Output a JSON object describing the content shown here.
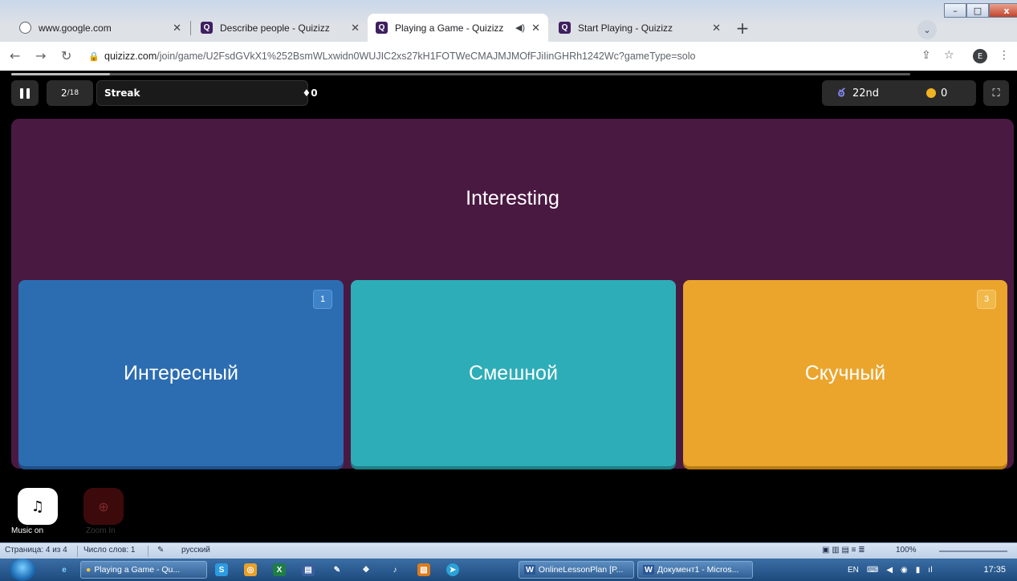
{
  "browser": {
    "tabs": [
      {
        "title": "www.google.com",
        "icon": "globe-icon"
      },
      {
        "title": "Describe people - Quizizz",
        "icon": "quizizz-icon"
      },
      {
        "title": "Playing a Game - Quizizz",
        "icon": "quizizz-icon",
        "active": true
      },
      {
        "title": "Start Playing - Quizizz",
        "icon": "quizizz-icon"
      }
    ],
    "tab_close_glyph": "✕",
    "new_tab_glyph": "+",
    "url_domain": "quizizz.com",
    "url_path": "/join/game/U2FsdGVkX1%252BsmWLxwidn0WUJIC2xs27kH1FOTWeCMAJMJMOfFJiIinGHRh1242Wc?gameType=solo",
    "profile_initial": "E"
  },
  "game": {
    "progress_fraction": 0.11,
    "question_number": "2",
    "question_total": "/18",
    "streak_label": "Streak",
    "streak_count": "0",
    "rank": "22nd",
    "coins": "0",
    "question_text": "Interesting",
    "options": [
      {
        "text": "Интересный",
        "key": "1",
        "color": "#2c6db2"
      },
      {
        "text": "Смешной",
        "key": "",
        "color": "#2dadb8"
      },
      {
        "text": "Скучный",
        "key": "3",
        "color": "#eba52c"
      }
    ],
    "card_color": "#4a1942",
    "music_label": "Music on",
    "zoom_label": "Zoom In"
  },
  "word_status": {
    "page": "Страница: 4 из 4",
    "words": "Число слов: 1",
    "language": "русский",
    "zoom": "100%"
  },
  "taskbar": {
    "items": [
      {
        "label": "Playing a Game - Qu...",
        "icon": "chrome-icon"
      },
      {
        "label": "OnlineLessonPlan [P...",
        "icon": "word-icon"
      },
      {
        "label": "Документ1 - Micros...",
        "icon": "word-icon"
      }
    ],
    "lang": "EN",
    "time": "17:35"
  }
}
